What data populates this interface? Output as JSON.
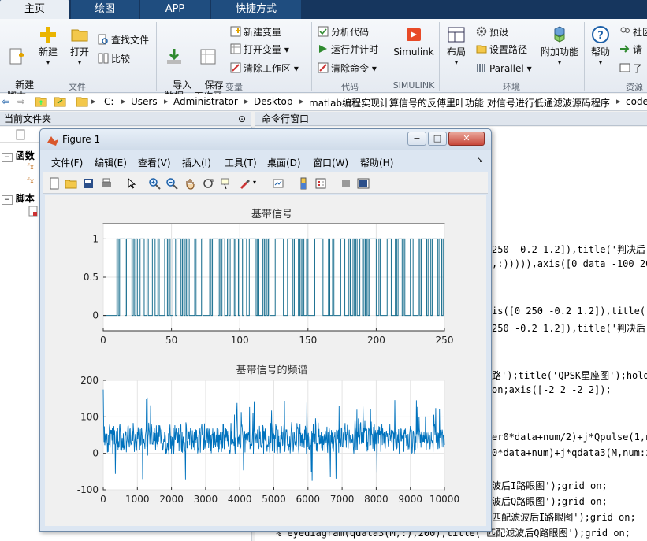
{
  "tabs": [
    {
      "label": "主页",
      "active": true
    },
    {
      "label": "绘图"
    },
    {
      "label": "APP"
    },
    {
      "label": "快捷方式"
    }
  ],
  "ribbon": {
    "file": {
      "new_script": "新建\n脚本",
      "new": "新建",
      "open": "打开",
      "find_files": "查找文件",
      "compare": "比较",
      "group": "文件"
    },
    "variable": {
      "import": "导入\n数据",
      "save_ws": "保存\n工作区",
      "new_var": "新建变量",
      "open_var": "打开变量",
      "clear_ws": "清除工作区",
      "group": "变量"
    },
    "code": {
      "analyze": "分析代码",
      "run_time": "运行并计时",
      "clear_cmd": "清除命令",
      "group": "代码"
    },
    "simulink": {
      "label": "Simulink",
      "group": "SIMULINK"
    },
    "env": {
      "layout": "布局",
      "prefs": "预设",
      "set_path": "设置路径",
      "parallel": "Parallel",
      "addons": "附加功能",
      "group": "环境"
    },
    "resources": {
      "help": "帮助",
      "community": "社区",
      "request": "请",
      "learn": "了",
      "group": "资源"
    }
  },
  "address": [
    "C:",
    "Users",
    "Administrator",
    "Desktop",
    "matlab编程实现计算信号的反傅里叶功能 对信号进行低通滤波源码程序",
    "code"
  ],
  "panels": {
    "current_folder": "当前文件夹",
    "command_window": "命令行窗口",
    "tree": [
      "函数",
      "脚本"
    ]
  },
  "command_lines": [
    "250 -0.2 1.2]),title('判决后",
    ",:))))),axis([0 data -100 20",
    "is([0 250 -0.2 1.2]),title('",
    "250 -0.2 1.2]),title('判决后",
    "路');title('QPSK星座图');hold",
    " on;axis([-2 2 -2 2]);",
    "er0*data+num/2)+j*Qpulse(1,n",
    "0*data+num)+j*qdata3(M,num:z",
    "波后I路眼图');grid on;",
    "波后Q路眼图');grid on;",
    "匹配滤波后I路眼图');grid on;",
    "% eyediagram(qdata3(M,:),200),title('匹配滤波后Q路眼图');grid on;"
  ],
  "figure": {
    "title": "Figure 1",
    "menu": [
      "文件(F)",
      "编辑(E)",
      "查看(V)",
      "插入(I)",
      "工具(T)",
      "桌面(D)",
      "窗口(W)",
      "帮助(H)"
    ],
    "win_buttons": [
      "−",
      "□",
      "✕"
    ]
  },
  "chart_data": [
    {
      "type": "line",
      "title": "基带信号",
      "xlim": [
        0,
        250
      ],
      "ylim": [
        -0.2,
        1.2
      ],
      "xticks": [
        "0",
        "50",
        "100",
        "150",
        "200",
        "250"
      ],
      "yticks": [
        "0",
        "0.5",
        "1"
      ],
      "grid": true,
      "series": [
        {
          "color": "#1a6f8f",
          "values": "binary sequence (250 samples)"
        }
      ]
    },
    {
      "type": "line",
      "title": "基带信号的频谱",
      "xlim": [
        0,
        10000
      ],
      "ylim": [
        -100,
        200
      ],
      "xticks": [
        "0",
        "1000",
        "2000",
        "3000",
        "4000",
        "5000",
        "6000",
        "7000",
        "8000",
        "9000",
        "10000"
      ],
      "yticks": [
        "-100",
        "0",
        "100",
        "200"
      ],
      "grid": true,
      "series": [
        {
          "color": "#0072bd",
          "values": "noisy spectrum ~40±30, spikes to ~150"
        }
      ]
    }
  ],
  "colors": {
    "tabbar": "#16365e",
    "line1": "#1a6f8f",
    "line2": "#0072bd"
  }
}
